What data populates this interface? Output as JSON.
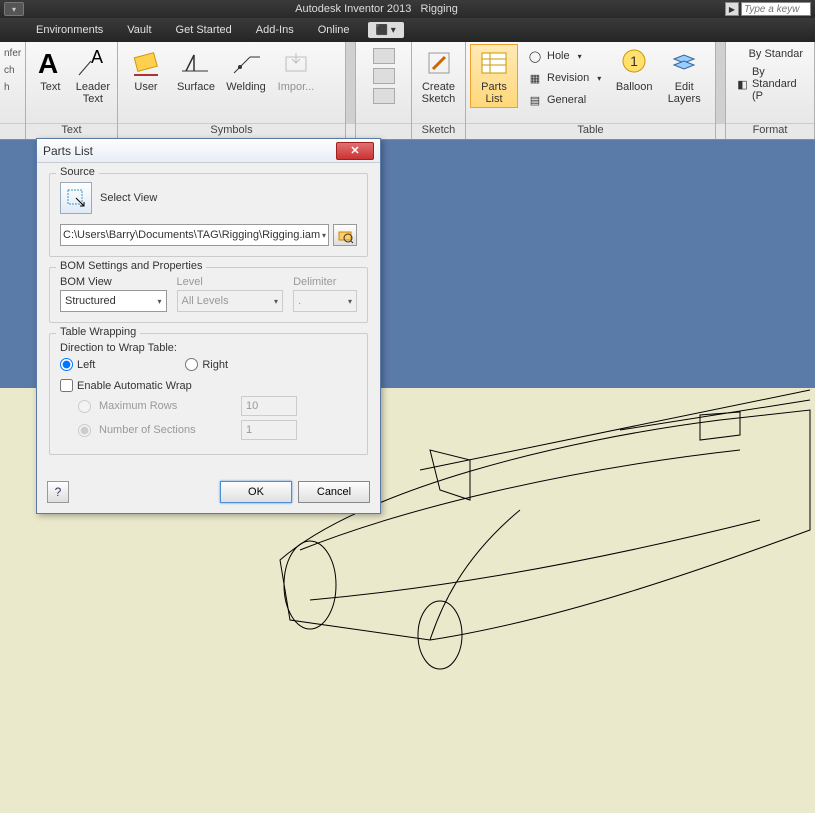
{
  "titlebar": {
    "app": "Autodesk Inventor 2013",
    "doc": "Rigging",
    "search_ph": "Type a keyw"
  },
  "menu": {
    "items": [
      "",
      "Environments",
      "Vault",
      "Get Started",
      "Add-Ins",
      "Online"
    ],
    "ext": "⬛ ▾"
  },
  "ribbon": {
    "frag_first": [
      "nfer",
      "ch",
      "h"
    ],
    "panel_text": {
      "label": "Text",
      "text_btn": "Text",
      "leader_btn": "Leader\nText"
    },
    "panel_symbols": {
      "label": "Symbols",
      "user": "User",
      "surface": "Surface",
      "welding": "Welding",
      "import": "Impor..."
    },
    "panel_sketch": {
      "label": "Sketch",
      "create": "Create\nSketch"
    },
    "panel_table": {
      "label": "Table",
      "parts": "Parts\nList",
      "hole": "Hole",
      "revision": "Revision",
      "general": "General",
      "balloon": "Balloon",
      "edit": "Edit\nLayers"
    },
    "panel_format": {
      "label": "Format",
      "by_std": "By Standar",
      "by_std2": "By Standard (P"
    }
  },
  "dialog": {
    "title": "Parts List",
    "source": {
      "legend": "Source",
      "select_view": "Select View",
      "path": "C:\\Users\\Barry\\Documents\\TAG\\Rigging\\Rigging.iam"
    },
    "bom": {
      "legend": "BOM Settings and Properties",
      "view_label": "BOM View",
      "view_value": "Structured",
      "level_label": "Level",
      "level_value": "All Levels",
      "delim_label": "Delimiter",
      "delim_value": "."
    },
    "wrap": {
      "legend": "Table Wrapping",
      "dir_label": "Direction to Wrap Table:",
      "left": "Left",
      "right": "Right",
      "enable": "Enable Automatic Wrap",
      "max_rows_label": "Maximum Rows",
      "max_rows": "10",
      "sections_label": "Number of Sections",
      "sections": "1"
    },
    "buttons": {
      "ok": "OK",
      "cancel": "Cancel"
    }
  }
}
